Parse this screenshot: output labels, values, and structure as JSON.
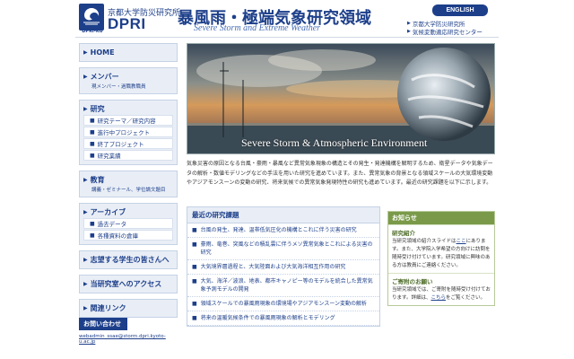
{
  "header": {
    "logo_caption": "DPRI-KU",
    "institute_ja": "京都大学防災研究所",
    "institute_abbr": "DPRI",
    "section_title": "暴風雨・極端気象研究領域",
    "section_subtitle": "Severe Storm and Extreme Weather",
    "language_button": "ENGLISH",
    "links": [
      "京都大学防災研究所",
      "気候変動適応研究センター"
    ]
  },
  "nav": {
    "home": "HOME",
    "members": {
      "label": "メンバー",
      "desc": "現メンバー・過職教職員"
    },
    "research": {
      "label": "研究",
      "items": [
        "研究テーマ／研究内容",
        "進行中プロジェクト",
        "終了プロジェクト",
        "研究業績"
      ]
    },
    "education": {
      "label": "教育",
      "desc": "講義・ゼミナール、学位論文題目"
    },
    "archive": {
      "label": "アーカイブ",
      "items": [
        "過去データ",
        "各種資料の倉庫"
      ]
    },
    "prospective": "志望する学生の皆さんへ",
    "access": "当研究室へのアクセス",
    "links": "関連リンク"
  },
  "contact": {
    "heading": "お問い合わせ",
    "email": "webadmin_ssae@storm.dpri.kyoto-u.ac.jp"
  },
  "hero": {
    "caption": "Severe Storm & Atmospheric Environment"
  },
  "intro": {
    "text": "気象災害の原因となる台風・豪雨・暴風など異常気象現象の構造とその発生・発達機構を解明するため、衛星データや気象データの解析・数値モデリングなどの手法を用いた研究を進めています。また、異常気象の背景となる領域スケールの大気環境変動やアジアモンスーンの変動の研究、将来気候での異常気象発現特性の研究も進めています。最近の研究課題を以下に示します。"
  },
  "topics": {
    "heading": "最近の研究課題",
    "items": [
      "台風の発生、発達、温帯低気圧化の機構とこれに伴う災害の研究",
      "豪雨、竜巻、突風などの積乱雲に伴うメソ異常気象とこれによる災害の研究",
      "大気境界層過程と、大気陸面および大気海洋相互作用の研究",
      "大気、海洋／波浪、地表、都市キャノピー等のモデルを統合した異常気象予測モデルの開発",
      "領域スケールでの暴風雨現象の環境場やアジアモンスーン変動の解析",
      "将来の温暖気候条件での暴風雨現象の解析とモデリング"
    ]
  },
  "news": {
    "heading": "お知らせ",
    "section1_title": "研究紹介",
    "section1_text_before": "当研究領域の紹介スライドは",
    "section1_link": "ここ",
    "section1_text_after": "にあります。また、大学院入学希望の方向けに訪問を随時受け付けています。研究領域に興味のある方は教員にご連絡ください。",
    "section2_title": "ご寄附のお願い",
    "section2_text_before": "当研究領域では、ご寄附を随時受け付けております。詳細は、",
    "section2_link": "こちら",
    "section2_text_after": "をご覧ください。"
  },
  "colors": {
    "brand": "#1d3f8a",
    "nav_bg": "#e9eef6",
    "news_accent": "#7a9a4a"
  }
}
